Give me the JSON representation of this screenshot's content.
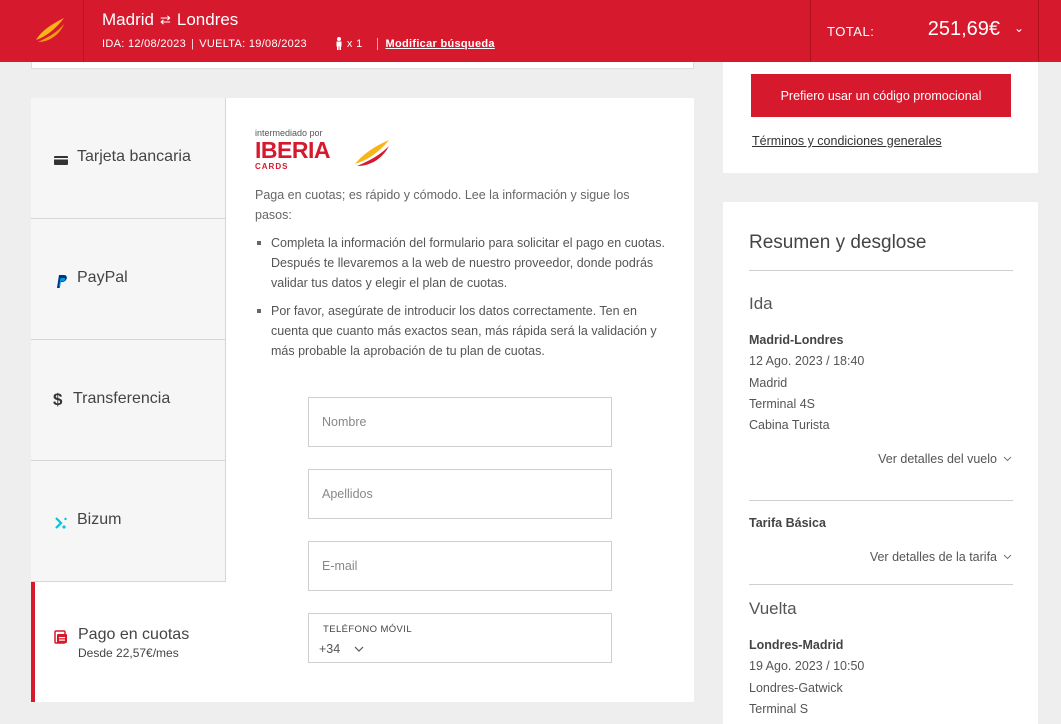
{
  "header": {
    "origin": "Madrid",
    "destination": "Londres",
    "swap_icon": "swap-arrows-icon",
    "outbound": "IDA: 12/08/2023",
    "return": "VUELTA: 19/08/2023",
    "passengers": "x 1",
    "modify": "Modificar búsqueda",
    "total_label": "TOTAL:",
    "total_value": "251,69€"
  },
  "payment_methods": [
    {
      "label": "Tarjeta bancaria",
      "icon": "credit-card-icon"
    },
    {
      "label": "PayPal",
      "icon": "paypal-icon"
    },
    {
      "label": "Transferencia",
      "icon": "dollar-transfer-icon"
    },
    {
      "label": "Bizum",
      "icon": "bizum-icon"
    },
    {
      "label": "Pago en cuotas",
      "sub": "Desde 22,57€/mes",
      "icon": "installments-icon",
      "active": true
    }
  ],
  "content": {
    "brand_top": "intermediado por",
    "brand_name": "IBERIA",
    "brand_sub": "CARDS",
    "intro": "Paga en cuotas; es rápido y cómodo. Lee la información y sigue los pasos:",
    "bullets": [
      "Completa la información del formulario para solicitar el pago en cuotas. Después te llevaremos a la web de nuestro proveedor, donde podrás validar tus datos y elegir el plan de cuotas.",
      "Por favor, asegúrate de introducir los datos correctamente. Ten en cuenta que cuanto más exactos sean, más rápida será la validación y más probable la aprobación de tu plan de cuotas."
    ],
    "form": {
      "name_placeholder": "Nombre",
      "surname_placeholder": "Apellidos",
      "email_placeholder": "E-mail",
      "phone_label": "TELÉFONO MÓVIL",
      "phone_prefix": "+34"
    }
  },
  "promo": {
    "button": "Prefiero usar un código promocional",
    "terms": "Términos y condiciones generales"
  },
  "summary": {
    "title": "Resumen y desglose",
    "outbound": {
      "title": "Ida",
      "route": "Madrid-Londres",
      "datetime": "12 Ago. 2023 / 18:40",
      "airport": "Madrid",
      "terminal": "Terminal 4S",
      "cabin": "Cabina Turista",
      "details": "Ver detalles del vuelo"
    },
    "fare": {
      "name": "Tarifa Básica",
      "details": "Ver detalles de la tarifa"
    },
    "return": {
      "title": "Vuelta",
      "route": "Londres-Madrid",
      "datetime": "19 Ago. 2023 / 10:50",
      "airport": "Londres-Gatwick",
      "terminal": "Terminal S"
    }
  },
  "colors": {
    "brand_red": "#d7192d",
    "page_bg": "#eeeeee"
  }
}
